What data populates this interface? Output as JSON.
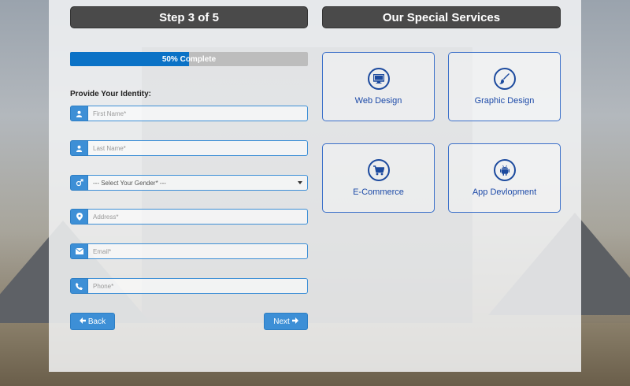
{
  "step_header": {
    "title": "Step 3 of 5"
  },
  "services_header": {
    "title": "Our Special Services"
  },
  "progress": {
    "label": "50% Complete",
    "percent": 50
  },
  "form": {
    "section_label": "Provide Your Identity:",
    "first_name_placeholder": "First Name*",
    "last_name_placeholder": "Last Name*",
    "gender_selected": "--- Select Your Gender* ---",
    "address_placeholder": "Address*",
    "email_placeholder": "Email*",
    "phone_placeholder": "Phone*"
  },
  "buttons": {
    "back_label": "Back",
    "next_label": "Next"
  },
  "services": [
    {
      "label": "Web Design",
      "icon": "monitor-icon"
    },
    {
      "label": "Graphic Design",
      "icon": "brush-icon"
    },
    {
      "label": "E-Commerce",
      "icon": "cart-icon"
    },
    {
      "label": "App Devlopment",
      "icon": "android-icon"
    }
  ],
  "colors": {
    "accent": "#3d8fd6",
    "progress": "#0b72c6",
    "header": "#4a4a4a",
    "service_text": "#1c4aa8"
  }
}
